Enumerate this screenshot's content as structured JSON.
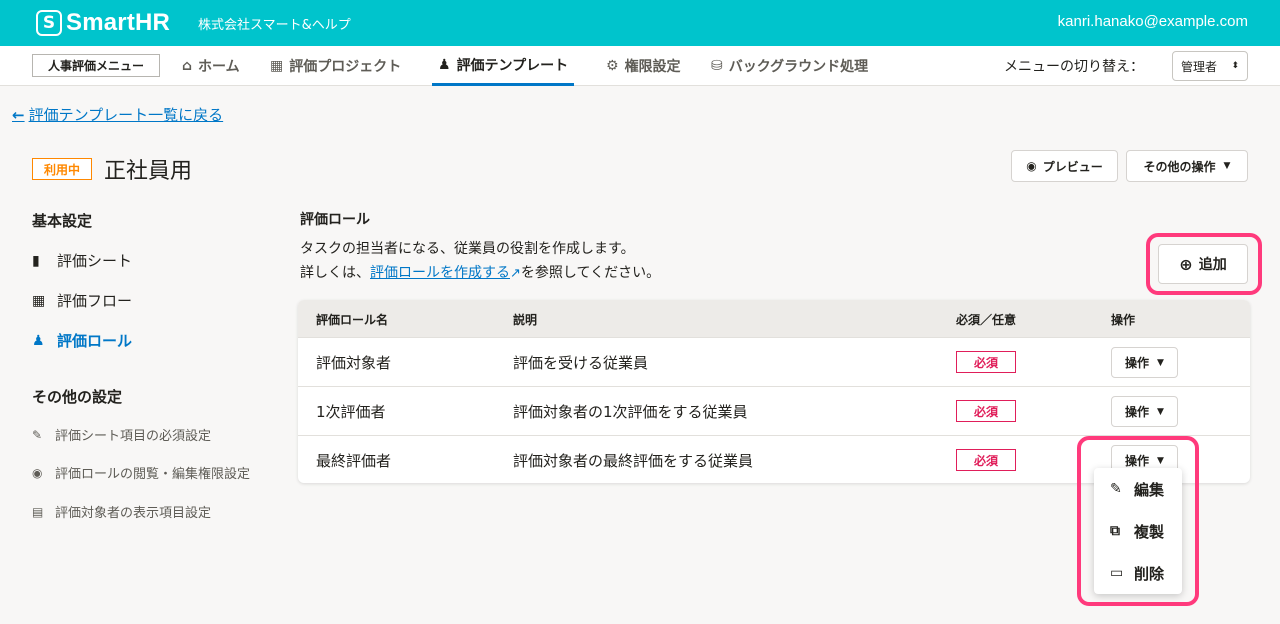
{
  "header": {
    "logo_mark": "S",
    "logo_text": "SmartHR",
    "company": "株式会社スマート&ヘルプ",
    "user_email": "kanri.hanako@example.com"
  },
  "nav": {
    "menu_label": "人事評価メニュー",
    "items": [
      {
        "label": "ホーム",
        "icon": "home-icon"
      },
      {
        "label": "評価プロジェクト",
        "icon": "calendar-icon"
      },
      {
        "label": "評価テンプレート",
        "icon": "users-icon"
      },
      {
        "label": "権限設定",
        "icon": "gear-icon"
      },
      {
        "label": "バックグラウンド処理",
        "icon": "database-icon"
      }
    ],
    "switch_label": "メニューの切り替え：",
    "role_value": "管理者"
  },
  "back_link": "評価テンプレート一覧に戻る",
  "template": {
    "status": "利用中",
    "title": "正社員用",
    "preview_label": "プレビュー",
    "other_actions_label": "その他の操作"
  },
  "sidebar": {
    "basic_heading": "基本設定",
    "basic_items": [
      {
        "label": "評価シート",
        "icon": "file-icon"
      },
      {
        "label": "評価フロー",
        "icon": "calendar-icon"
      },
      {
        "label": "評価ロール",
        "icon": "users-icon"
      }
    ],
    "other_heading": "その他の設定",
    "other_items": [
      {
        "label": "評価シート項目の必須設定",
        "icon": "pencil-icon"
      },
      {
        "label": "評価ロールの閲覧・編集権限設定",
        "icon": "eye-icon"
      },
      {
        "label": "評価対象者の表示項目設定",
        "icon": "id-card-icon"
      }
    ]
  },
  "main": {
    "section_title": "評価ロール",
    "description_line1": "タスクの担当者になる、従業員の役割を作成します。",
    "description_pre": "詳しくは、",
    "description_link": "評価ロールを作成する",
    "description_post": "を参照してください。",
    "add_label": "追加"
  },
  "table": {
    "headers": [
      "評価ロール名",
      "説明",
      "必須／任意",
      "操作"
    ],
    "rows": [
      {
        "name": "評価対象者",
        "description": "評価を受ける従業員",
        "required": "必須",
        "action": "操作"
      },
      {
        "name": "1次評価者",
        "description": "評価対象者の1次評価をする従業員",
        "required": "必須",
        "action": "操作"
      },
      {
        "name": "最終評価者",
        "description": "評価対象者の最終評価をする従業員",
        "required": "必須",
        "action": "操作"
      }
    ]
  },
  "dropdown": {
    "items": [
      {
        "label": "編集",
        "icon": "edit-icon"
      },
      {
        "label": "複製",
        "icon": "copy-icon"
      },
      {
        "label": "削除",
        "icon": "trash-icon"
      }
    ]
  },
  "colors": {
    "header": "#00c4cc",
    "link": "#0077c7",
    "highlight": "#ff3a7c",
    "required": "#e01e5a",
    "in_use": "#ff8800"
  }
}
